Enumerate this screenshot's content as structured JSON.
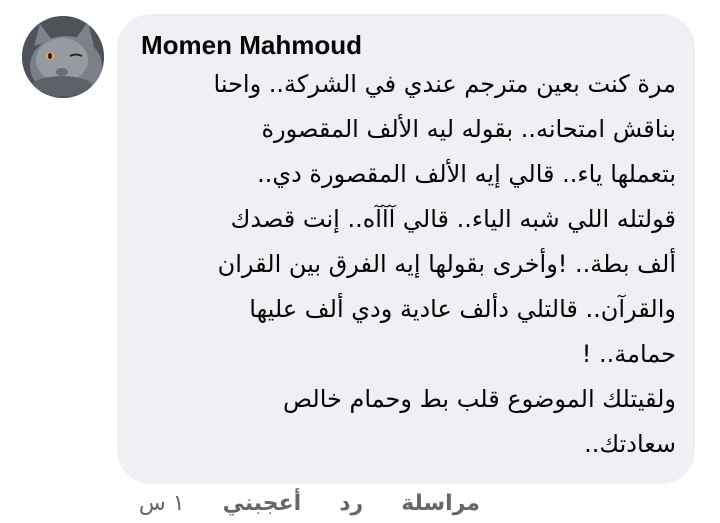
{
  "comment": {
    "author": "Momen Mahmoud",
    "body_lines": [
      "مرة كنت بعين مترجم عندي في الشركة.. واحنا",
      "بناقش امتحانه.. بقوله ليه الألف المقصورة",
      "بتعملها ياء.. قالي إيه الألف المقصورة دي..",
      "قولتله اللي شبه الياء.. قالي آآآه.. إنت قصدك",
      "ألف بطة.. !وأخرى بقولها إيه الفرق بين القران",
      "والقرآن.. قالتلي دألف عادية ودي ألف عليها",
      "حمامة.. !",
      "ولقيتلك الموضوع قلب بط وحمام خالص",
      "سعادتك.."
    ],
    "actions": {
      "message": "مراسلة",
      "reply": "رد",
      "like": "أعجبني",
      "time": "١ س"
    },
    "avatar_icon": "cat-avatar-icon",
    "bubble_color": "#eef0f3",
    "meta_color": "#65676b"
  }
}
